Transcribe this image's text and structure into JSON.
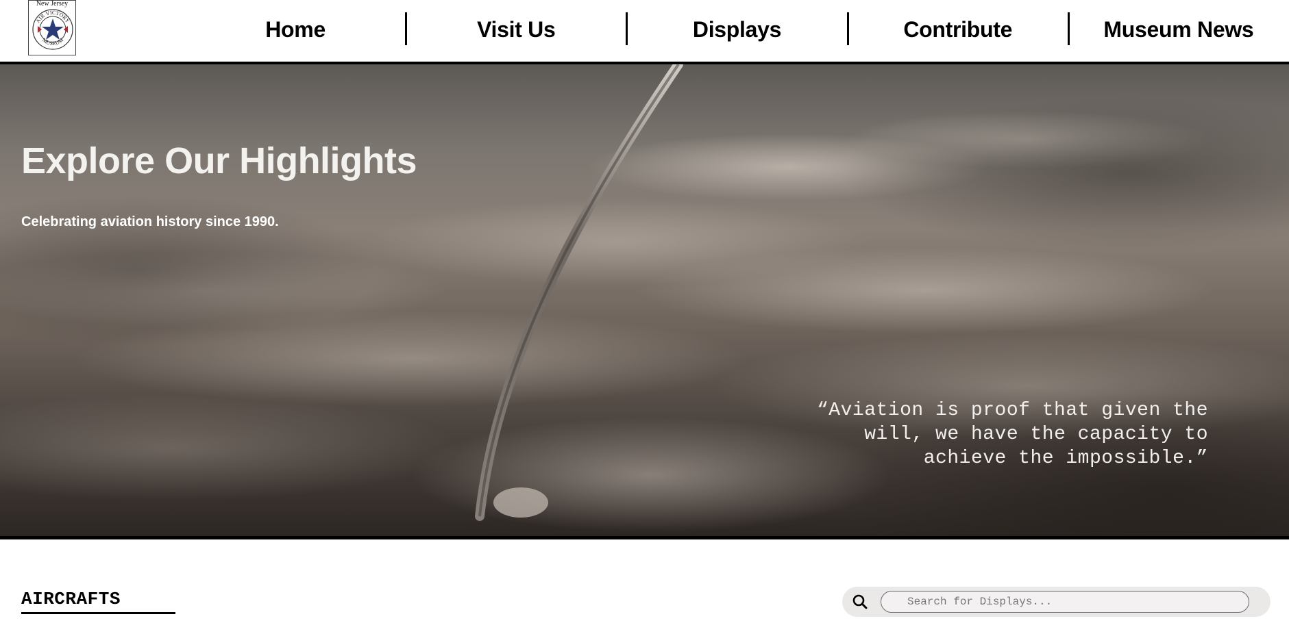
{
  "header": {
    "logo": {
      "caption": "New Jersey",
      "ring_top_text": "AIR VICTORY",
      "ring_bottom_text": "MUSEUM",
      "icon": "star-emblem-icon"
    },
    "nav": [
      {
        "label": "Home"
      },
      {
        "label": "Visit Us"
      },
      {
        "label": "Displays"
      },
      {
        "label": "Contribute"
      },
      {
        "label": "Museum News"
      }
    ]
  },
  "hero": {
    "title": "Explore Our Highlights",
    "subtitle": "Celebrating aviation history since 1990.",
    "quote": "“Aviation is proof that given the will, we have the capacity to achieve the impossible.”"
  },
  "section": {
    "title": "AIRCRAFTS"
  },
  "search": {
    "placeholder": "Search for Displays...",
    "value": "",
    "icon": "search-icon"
  },
  "colors": {
    "header_bg": "#ffffff",
    "nav_text": "#000000",
    "hero_text": "#f4f2ef",
    "search_bg": "#ebe8e8",
    "logo_star": "#2b3a78",
    "logo_accent": "#b0272d"
  }
}
